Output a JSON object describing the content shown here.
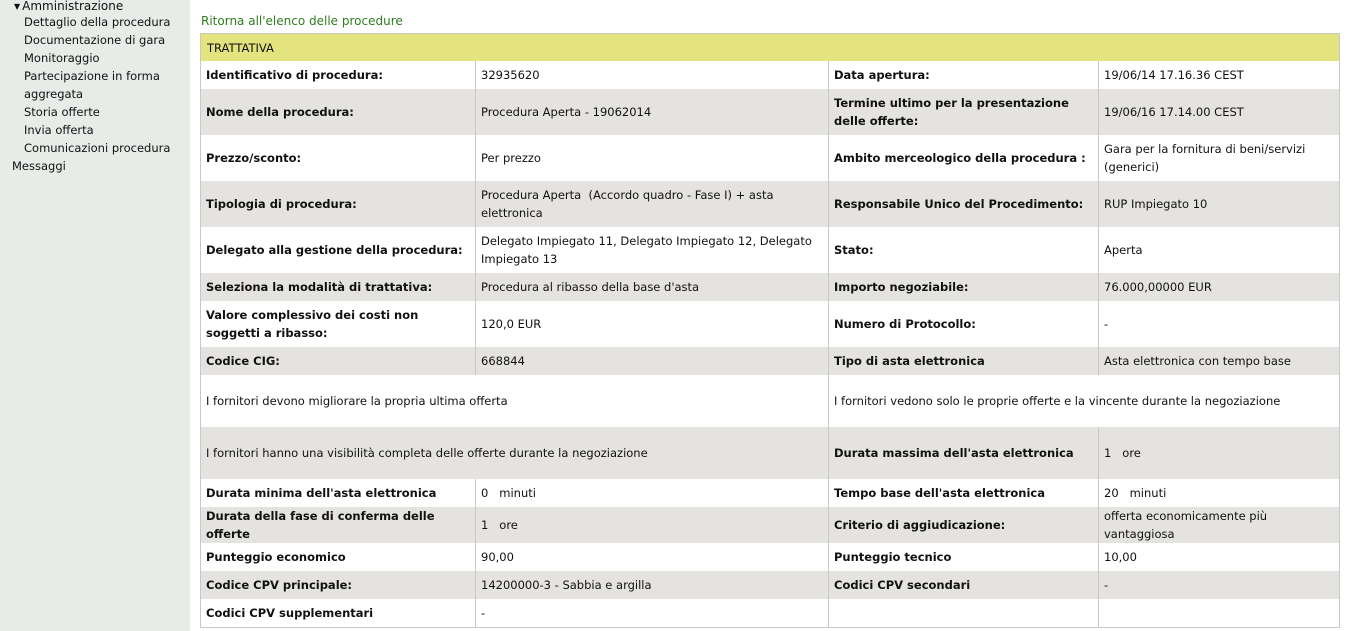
{
  "sidebar": {
    "section": "Amministrazione",
    "items": [
      {
        "label": "Dettaglio della procedura",
        "active": true
      },
      {
        "label": "Documentazione di gara"
      },
      {
        "label": "Monitoraggio"
      },
      {
        "label": "Partecipazione in forma"
      },
      {
        "label": "aggregata"
      },
      {
        "label": "Storia offerte"
      },
      {
        "label": "Invia offerta"
      },
      {
        "label": "Comunicazioni procedura"
      }
    ],
    "messages": "Messaggi"
  },
  "back_link": "Ritorna all'elenco delle procedure",
  "table": {
    "title": "TRATTATIVA",
    "rows": [
      {
        "l1": "Identificativo di procedura:",
        "v1": "32935620",
        "l2": "Data apertura:",
        "v2": "19/06/14 17.16.36 CEST"
      },
      {
        "l1": "Nome della procedura:",
        "v1": "Procedura Aperta - 19062014",
        "l2": "Termine ultimo per la presentazione delle offerte:",
        "v2": "19/06/16 17.14.00 CEST"
      },
      {
        "l1": "Prezzo/sconto:",
        "v1": "Per prezzo",
        "l2": "Ambito merceologico della procedura :",
        "v2": "Gara per la fornitura di beni/servizi (generici)"
      },
      {
        "l1": "Tipologia di procedura:",
        "v1": "Procedura Aperta  (Accordo quadro - Fase I) + asta elettronica",
        "l2": "Responsabile Unico del Procedimento:",
        "v2": "RUP Impiegato 10"
      },
      {
        "l1": "Delegato alla gestione della procedura:",
        "v1": "Delegato Impiegato 11, Delegato Impiegato 12, Delegato Impiegato 13",
        "l2": "Stato:",
        "v2": "Aperta"
      },
      {
        "l1": "Seleziona la modalità di trattativa:",
        "v1": "Procedura al ribasso della base d'asta",
        "l2": "Importo negoziabile:",
        "v2": "76.000,00000 EUR"
      },
      {
        "l1": "Valore complessivo dei costi non soggetti a ribasso:",
        "v1": "120,0 EUR",
        "l2": "Numero di Protocollo:",
        "v2": "-"
      },
      {
        "l1": "Codice CIG:",
        "v1": "668844",
        "l2": "Tipo di asta elettronica",
        "v2": "Asta elettronica con tempo base"
      },
      {
        "span1": "I fornitori devono migliorare la propria ultima offerta",
        "span2": "I fornitori vedono solo le proprie offerte e la vincente durante la negoziazione"
      },
      {
        "span1": "I fornitori hanno una visibilità completa delle offerte durante la negoziazione",
        "l2": "Durata massima dell'asta elettronica",
        "v2": "1   ore"
      },
      {
        "l1": "Durata minima dell'asta elettronica",
        "v1": "0   minuti",
        "l2": "Tempo base dell'asta elettronica",
        "v2": "20   minuti"
      },
      {
        "l1": "Durata della fase di conferma delle offerte",
        "v1": "1   ore",
        "l2": "Criterio di aggiudicazione:",
        "v2": "offerta economicamente più vantaggiosa"
      },
      {
        "l1": "Punteggio economico",
        "v1": "90,00",
        "l2": "Punteggio tecnico",
        "v2": "10,00"
      },
      {
        "l1": "Codice CPV principale:",
        "v1": "14200000-3 - Sabbia e argilla",
        "l2": "Codici CPV secondari",
        "v2": "-"
      },
      {
        "l1": "Codici CPV supplementari",
        "v1": "-",
        "l2": "",
        "v2": ""
      }
    ]
  }
}
